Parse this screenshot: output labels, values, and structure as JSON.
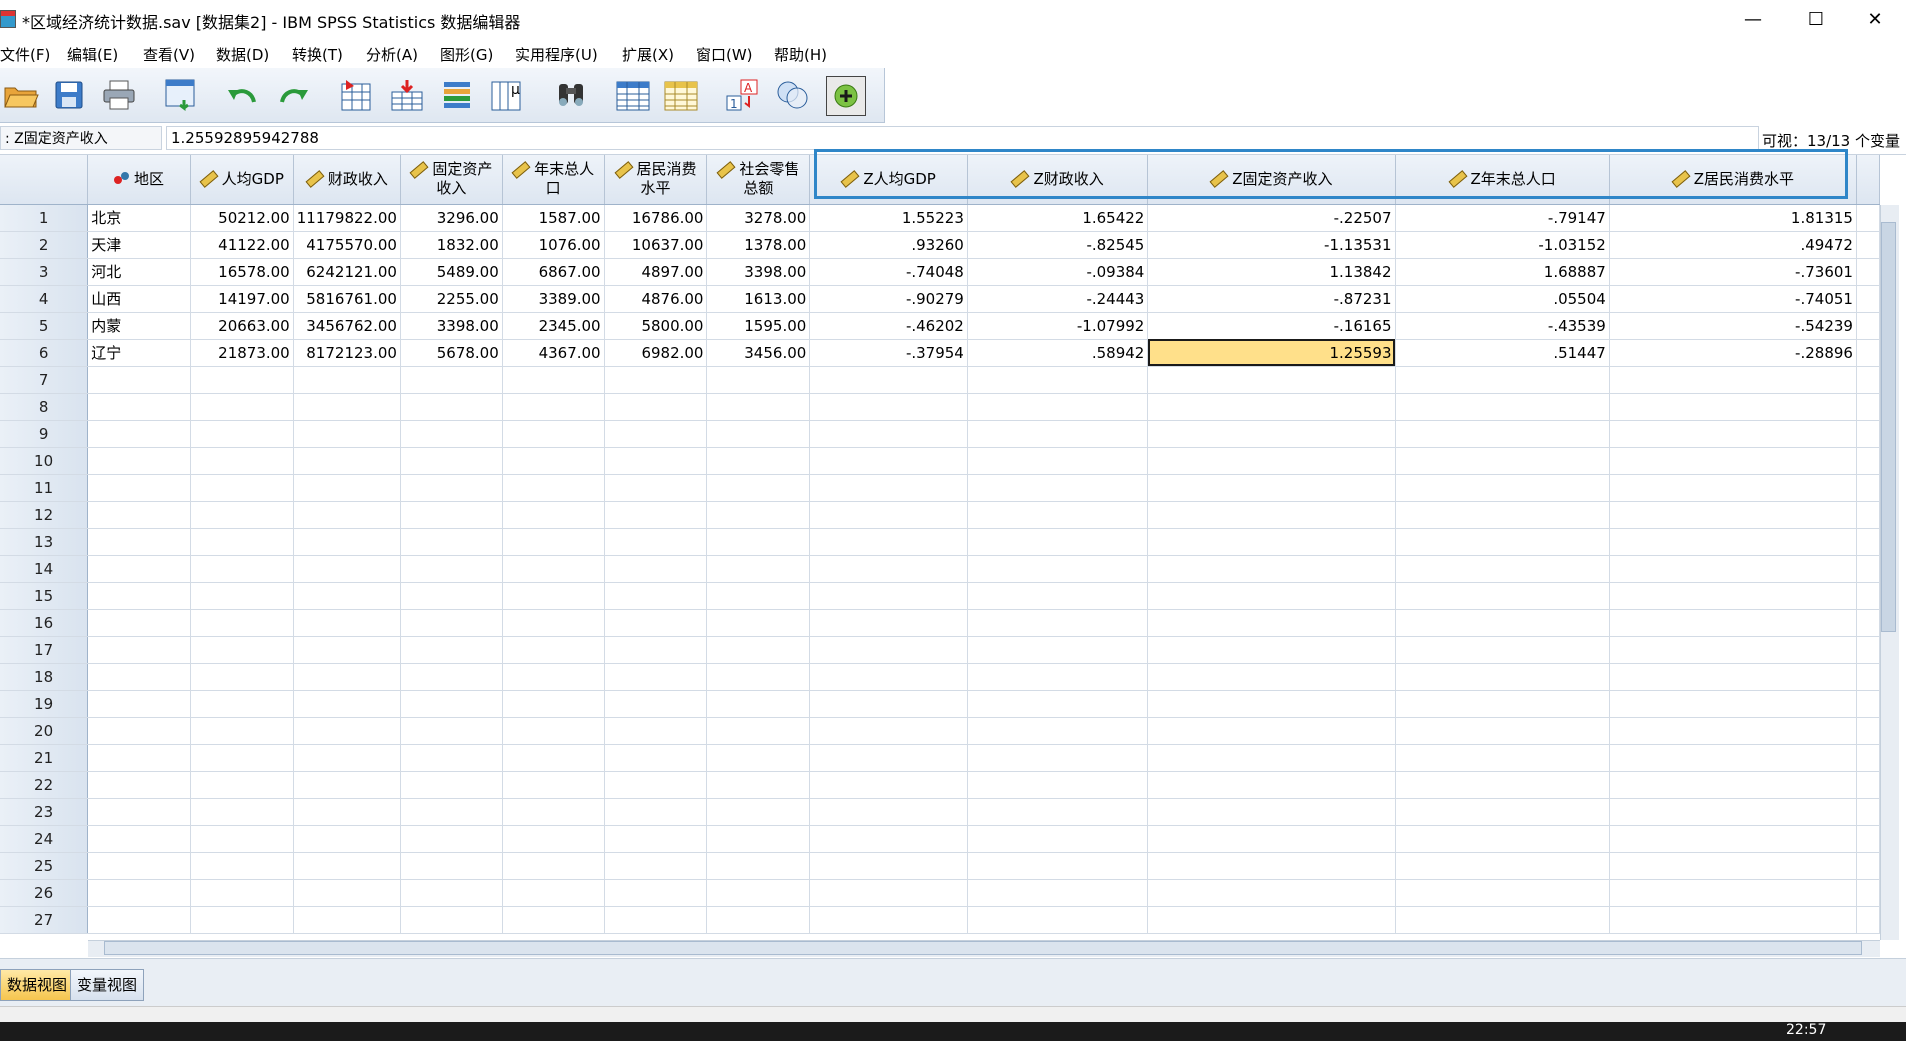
{
  "window": {
    "title": "*区域经济统计数据.sav [数据集2] - IBM SPSS Statistics 数据编辑器",
    "minimize": "—",
    "maximize": "☐",
    "close": "✕"
  },
  "menu": [
    "文件(F)",
    "编辑(E)",
    "查看(V)",
    "数据(D)",
    "转换(T)",
    "分析(A)",
    "图形(G)",
    "实用程序(U)",
    "扩展(X)",
    "窗口(W)",
    "帮助(H)"
  ],
  "toolbar_icons": [
    "open-icon",
    "save-icon",
    "print-icon",
    "recall-dialog-icon",
    "undo-icon",
    "redo-icon",
    "goto-case-icon",
    "goto-variable-icon",
    "variables-icon",
    "run-descriptive-icon",
    "find-icon",
    "insert-cases-icon",
    "insert-variable-icon",
    "split-file-icon",
    "value-labels-icon",
    "use-sets-icon",
    "spelling-icon"
  ],
  "editor": {
    "cell_name": ": Z固定资产收入",
    "cell_value": "1.25592895942788",
    "visible": "可视：13/13 个变量"
  },
  "columns": [
    "地区",
    "人均GDP",
    "财政收入",
    "固定资产收入",
    "年末总人口",
    "居民消费水平",
    "社会零售总额",
    "Z人均GDP",
    "Z财政收入",
    "Z固定资产收入",
    "Z年末总人口",
    "Z居民消费水平"
  ],
  "rows": [
    [
      "北京",
      "50212.00",
      "11179822.00",
      "3296.00",
      "1587.00",
      "16786.00",
      "3278.00",
      "1.55223",
      "1.65422",
      "-.22507",
      "-.79147",
      "1.81315"
    ],
    [
      "天津",
      "41122.00",
      "4175570.00",
      "1832.00",
      "1076.00",
      "10637.00",
      "1378.00",
      ".93260",
      "-.82545",
      "-1.13531",
      "-1.03152",
      ".49472"
    ],
    [
      "河北",
      "16578.00",
      "6242121.00",
      "5489.00",
      "6867.00",
      "4897.00",
      "3398.00",
      "-.74048",
      "-.09384",
      "1.13842",
      "1.68887",
      "-.73601"
    ],
    [
      "山西",
      "14197.00",
      "5816761.00",
      "2255.00",
      "3389.00",
      "4876.00",
      "1613.00",
      "-.90279",
      "-.24443",
      "-.87231",
      ".05504",
      "-.74051"
    ],
    [
      "内蒙",
      "20663.00",
      "3456762.00",
      "3398.00",
      "2345.00",
      "5800.00",
      "1595.00",
      "-.46202",
      "-1.07992",
      "-.16165",
      "-.43539",
      "-.54239"
    ],
    [
      "辽宁",
      "21873.00",
      "8172123.00",
      "5678.00",
      "4367.00",
      "6982.00",
      "3456.00",
      "-.37954",
      ".58942",
      "1.25593",
      ".51447",
      "-.28896"
    ]
  ],
  "row_numbers": [
    "1",
    "2",
    "3",
    "4",
    "5",
    "6",
    "7",
    "8",
    "9",
    "10",
    "11",
    "12",
    "13",
    "14",
    "15",
    "16",
    "17",
    "18",
    "19",
    "20",
    "21",
    "22",
    "23",
    "24",
    "25",
    "26",
    "27"
  ],
  "tabs": {
    "data_view": "数据视图",
    "variable_view": "变量视图"
  },
  "clock": "22:57",
  "selected": {
    "row": 6,
    "column": "Z固定资产收入"
  }
}
